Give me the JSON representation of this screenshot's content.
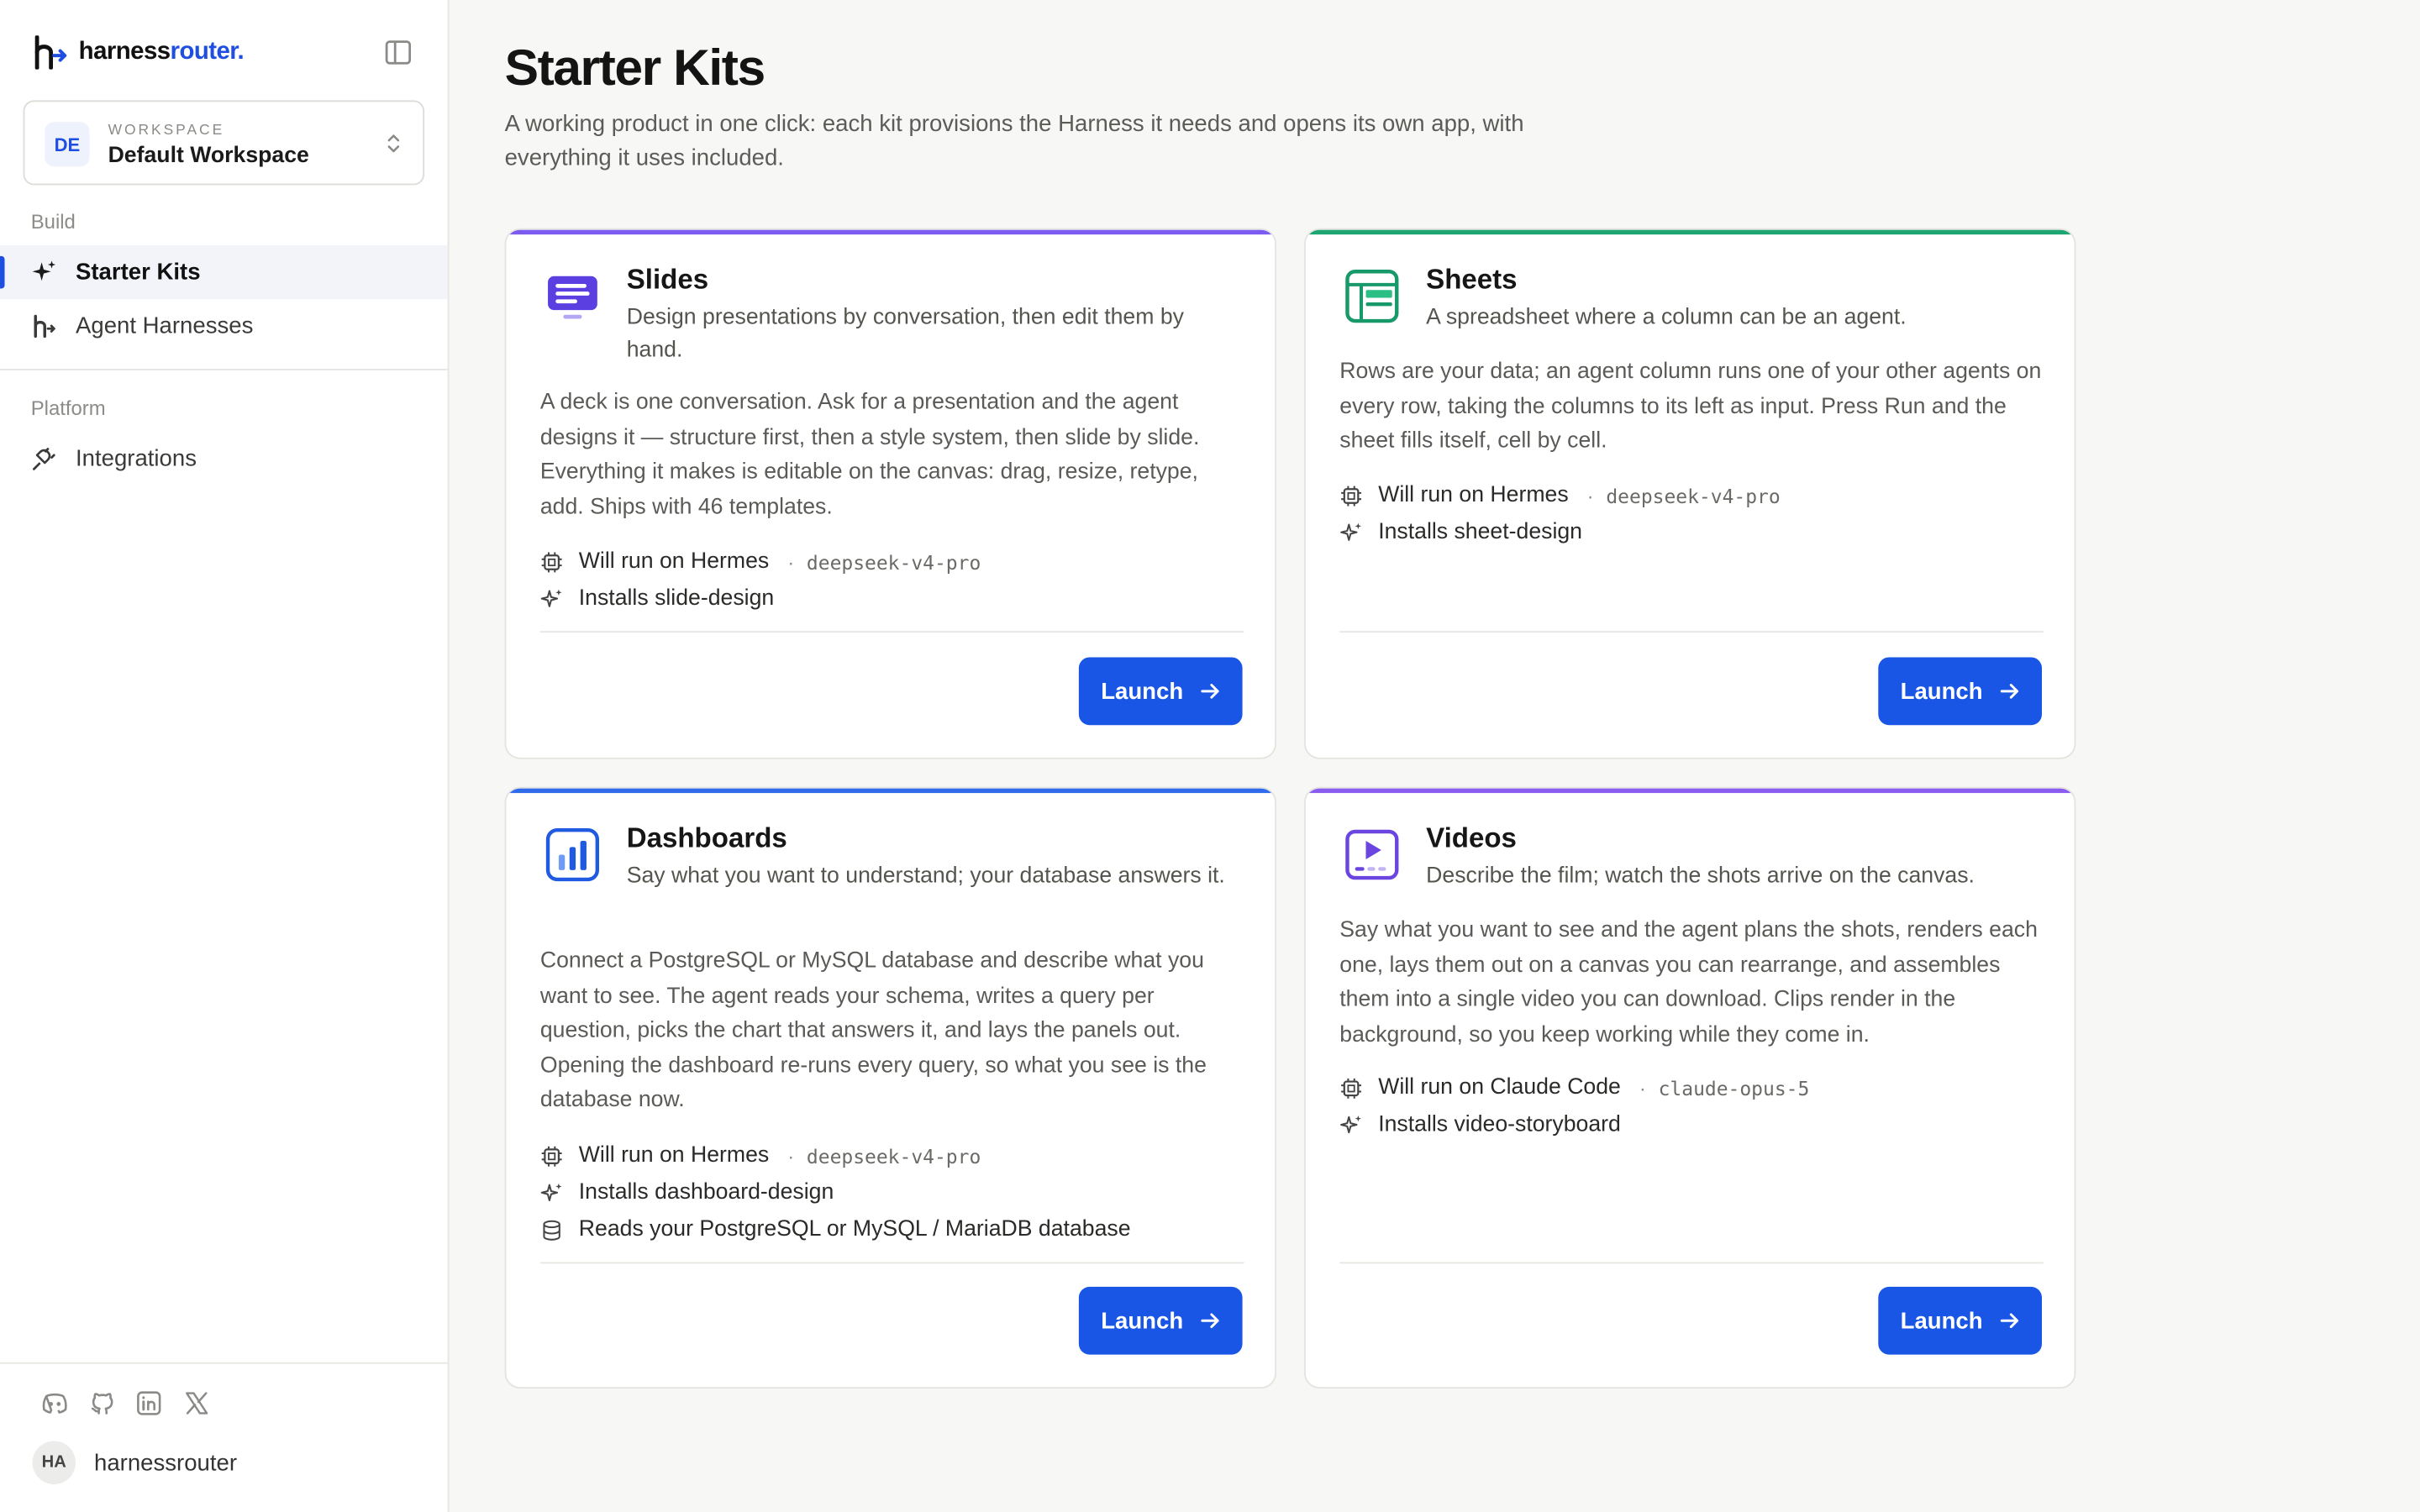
{
  "brand": {
    "name_part1": "harness",
    "name_part2": "router."
  },
  "workspace": {
    "caption": "WORKSPACE",
    "initials": "DE",
    "name": "Default Workspace"
  },
  "sidebar": {
    "sections": [
      {
        "label": "Build",
        "items": [
          {
            "label": "Starter Kits",
            "icon": "sparkles-icon",
            "active": true
          },
          {
            "label": "Agent Harnesses",
            "icon": "harness-logo-icon",
            "active": false
          }
        ]
      },
      {
        "label": "Platform",
        "items": [
          {
            "label": "Integrations",
            "icon": "plug-icon",
            "active": false
          }
        ]
      }
    ],
    "social_icons": [
      "discord-icon",
      "github-icon",
      "linkedin-icon",
      "x-icon"
    ],
    "user": {
      "initials": "HA",
      "name": "harnessrouter"
    }
  },
  "page": {
    "title": "Starter Kits",
    "subtitle": "A working product in one click: each kit provisions the Harness it needs and opens its own app, with everything it uses included."
  },
  "kits": [
    {
      "name": "Slides",
      "accent": "#7c5cf0",
      "icon": "slides-icon",
      "tagline": "Design presentations by conversation, then edit them by hand.",
      "description": "A deck is one conversation. Ask for a presentation and the agent designs it — structure first, then a style system, then slide by slide. Everything it makes is editable on the canvas: drag, resize, retype, add. Ships with 46 templates.",
      "runs_on": "Will run on Hermes",
      "model": "deepseek-v4-pro",
      "installs": "Installs slide-design",
      "launch": "Launch"
    },
    {
      "name": "Sheets",
      "accent": "#1ea672",
      "icon": "sheets-icon",
      "tagline": "A spreadsheet where a column can be an agent.",
      "description": "Rows are your data; an agent column runs one of your other agents on every row, taking the columns to its left as input. Press Run and the sheet fills itself, cell by cell.",
      "runs_on": "Will run on Hermes",
      "model": "deepseek-v4-pro",
      "installs": "Installs sheet-design",
      "launch": "Launch"
    },
    {
      "name": "Dashboards",
      "accent": "#2f6bea",
      "icon": "dashboard-chart-icon",
      "tagline": "Say what you want to understand; your database answers it.",
      "description": "Connect a PostgreSQL or MySQL database and describe what you want to see. The agent reads your schema, writes a query per question, picks the chart that answers it, and lays the panels out. Opening the dashboard re-runs every query, so what you see is the database now.",
      "runs_on": "Will run on Hermes",
      "model": "deepseek-v4-pro",
      "installs": "Installs dashboard-design",
      "reads": "Reads your PostgreSQL or MySQL / MariaDB database",
      "launch": "Launch"
    },
    {
      "name": "Videos",
      "accent": "#8b5cf0",
      "icon": "video-play-icon",
      "tagline": "Describe the film; watch the shots arrive on the canvas.",
      "description": "Say what you want to see and the agent plans the shots, renders each one, lays them out on a canvas you can rearrange, and assembles them into a single video you can download. Clips render in the background, so you keep working while they come in.",
      "runs_on": "Will run on Claude Code",
      "model": "claude-opus-5",
      "installs": "Installs video-storyboard",
      "launch": "Launch"
    }
  ]
}
